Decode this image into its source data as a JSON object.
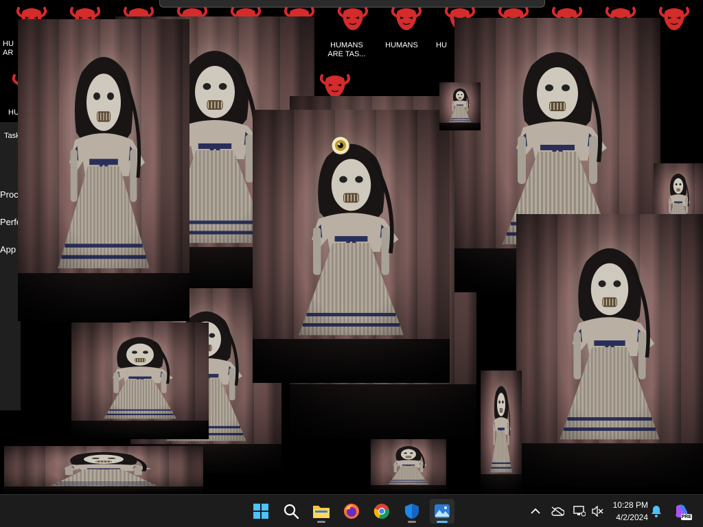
{
  "desktop": {
    "icons": [
      {
        "label": "HUMANS ARE TAS..."
      },
      {
        "label": "HUMANS"
      },
      {
        "label": "HU"
      },
      {
        "label": "HU AR"
      },
      {
        "label": "HU"
      }
    ]
  },
  "task_manager": {
    "title": "Task",
    "items": [
      "Proc",
      "Perfo",
      "App"
    ]
  },
  "taskbar": {
    "apps": [
      {
        "name": "start",
        "icon": "windows-start-icon"
      },
      {
        "name": "search",
        "icon": "search-icon"
      },
      {
        "name": "file-explorer",
        "icon": "folder-icon"
      },
      {
        "name": "firefox",
        "icon": "firefox-icon"
      },
      {
        "name": "chrome",
        "icon": "chrome-icon"
      },
      {
        "name": "defender",
        "icon": "shield-icon"
      },
      {
        "name": "photos",
        "icon": "photos-icon"
      }
    ],
    "tray": {
      "time": "10:28 PM",
      "date": "4/2/2024",
      "copilot_badge": "PRE"
    }
  },
  "colors": {
    "taskbar_bg": "#1c1c1c",
    "accent": "#4cc2ff",
    "icon_red": "#d42b2b"
  }
}
